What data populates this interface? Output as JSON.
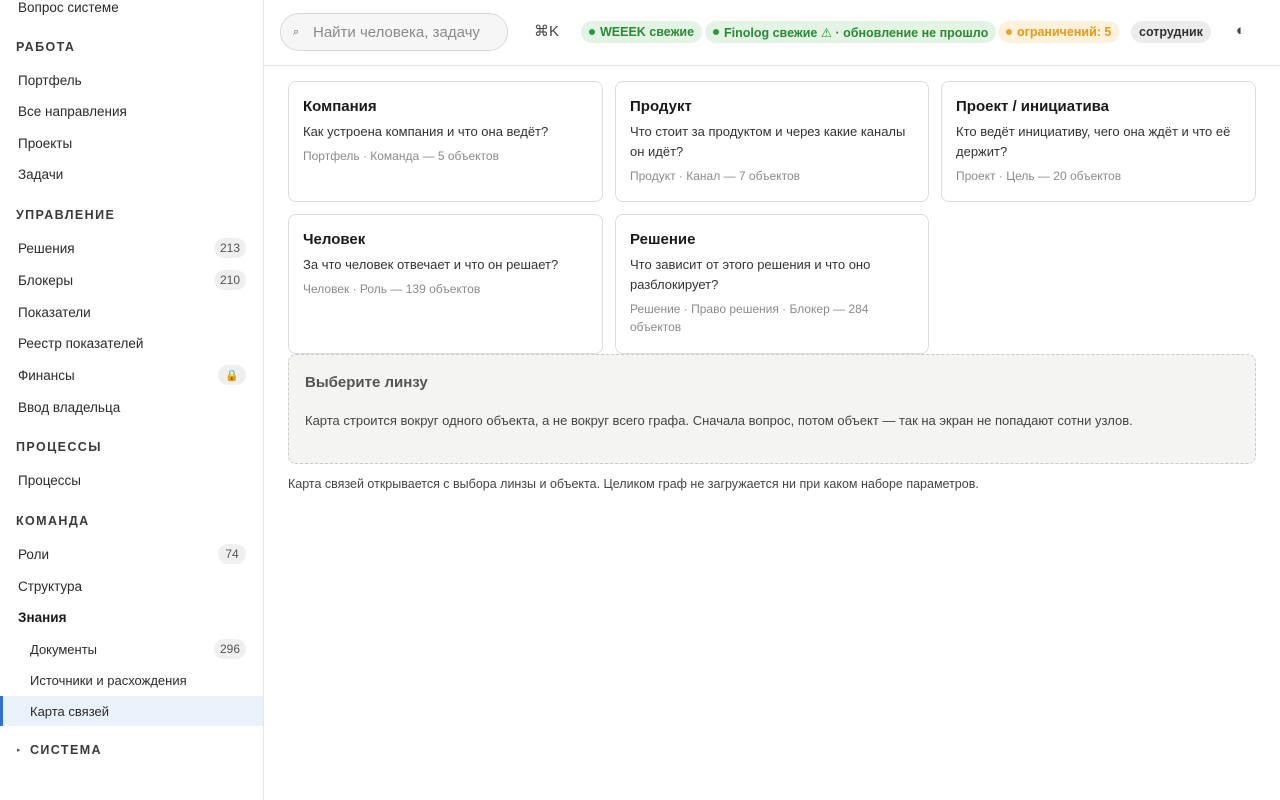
{
  "sidebar": {
    "top_item": "Вопрос системе",
    "sections": {
      "work": "РАБОТА",
      "management": "УПРАВЛЕНИЕ",
      "processes": "ПРОЦЕССЫ",
      "team": "КОМАНДА",
      "system": "СИСТЕМА"
    },
    "work_items": [
      "Портфель",
      "Все направления",
      "Проекты",
      "Задачи"
    ],
    "management_items": [
      {
        "label": "Решения",
        "count": "213"
      },
      {
        "label": "Блокеры",
        "count": "210"
      },
      {
        "label": "Показатели"
      },
      {
        "label": "Реестр показателей"
      },
      {
        "label": "Финансы",
        "lock": "🔒"
      },
      {
        "label": "Ввод владельца"
      }
    ],
    "process_items": [
      "Процессы"
    ],
    "team_items": [
      {
        "label": "Роли",
        "count": "74"
      },
      {
        "label": "Структура"
      },
      {
        "label": "Знания"
      }
    ],
    "knowledge_items": [
      {
        "label": "Документы",
        "count": "296"
      },
      {
        "label": "Источники и расхождения"
      },
      {
        "label": "Карта связей"
      }
    ]
  },
  "topbar": {
    "search_placeholder": "Найти человека, задачу",
    "shortcut": "⌘K",
    "status_weeek": "WEEEK свежие",
    "status_finolog": "Finolog свежие ⚠ · обновление не прошло",
    "limits": "ограничений: 5",
    "role": "сотрудник",
    "theme_icon": "◐"
  },
  "cards": [
    {
      "title": "Компания",
      "question": "Как устроена компания и что она ведёт?",
      "meta": "Портфель · Команда — 5 объектов"
    },
    {
      "title": "Продукт",
      "question": "Что стоит за продуктом и через какие каналы он идёт?",
      "meta": "Продукт · Канал — 7 объектов"
    },
    {
      "title": "Проект / инициатива",
      "question": "Кто ведёт инициативу, чего она ждёт и что её держит?",
      "meta": "Проект · Цель — 20 объектов"
    },
    {
      "title": "Человек",
      "question": "За что человек отвечает и что он решает?",
      "meta": "Человек · Роль — 139 объектов"
    },
    {
      "title": "Решение",
      "question": "Что зависит от этого решения и что оно разблокирует?",
      "meta": "Решение · Право решения · Блокер — 284 объектов"
    }
  ],
  "lens_panel": {
    "title": "Выберите линзу",
    "description": "Карта строится вокруг одного объекта, а не вокруг всего графа. Сначала вопрос, потом объект — так на экран не попадают сотни узлов."
  },
  "footer_note": "Карта связей открывается с выбора линзы и объекта. Целиком граф не загружается ни при каком наборе параметров.",
  "colors": {
    "accent": "#2f6fd6",
    "status_green": "#2a8a35",
    "status_amber": "#e29a17",
    "active_bg": "#e9f1fb"
  }
}
